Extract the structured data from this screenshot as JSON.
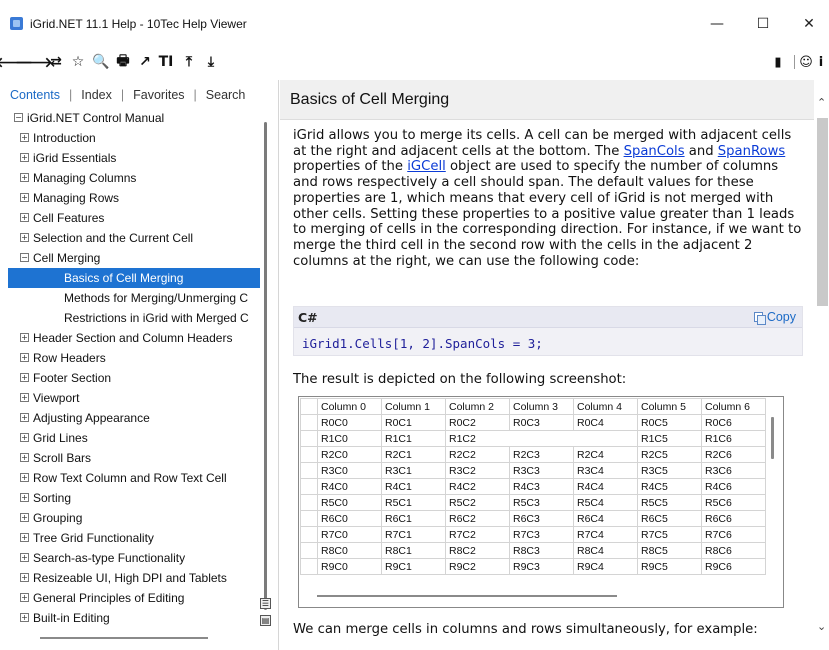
{
  "window": {
    "title": "iGrid.NET 11.1 Help - 10Tec Help Viewer",
    "minimize": "—",
    "maximize": "☐",
    "close": "✕"
  },
  "toolbar": {
    "left_icons": [
      {
        "name": "back-icon",
        "glyph": "🡐"
      },
      {
        "name": "forward-icon",
        "glyph": "🡒"
      },
      {
        "name": "sync-icon",
        "glyph": "⇄"
      },
      {
        "name": "add-favorite-icon",
        "glyph": "☆"
      },
      {
        "name": "search-icon",
        "glyph": "🔍"
      },
      {
        "name": "print-icon",
        "glyph": "🖶"
      },
      {
        "name": "open-external-icon",
        "glyph": "↗"
      },
      {
        "name": "font-size-icon",
        "glyph": "TI"
      },
      {
        "name": "scroll-top-icon",
        "glyph": "⤒"
      },
      {
        "name": "scroll-bottom-icon",
        "glyph": "⤓"
      }
    ],
    "right_icons": [
      {
        "name": "book-icon",
        "glyph": "▮"
      },
      {
        "name": "smiley-icon",
        "glyph": "☺"
      },
      {
        "name": "info-icon",
        "glyph": "i"
      }
    ]
  },
  "nav": {
    "tabs": [
      "Contents",
      "Index",
      "Favorites",
      "Search"
    ],
    "active_tab": "Contents"
  },
  "tree": [
    {
      "label": "iGrid.NET Control Manual",
      "indent": 0,
      "expander": "−"
    },
    {
      "label": "Introduction",
      "indent": 1,
      "expander": "+"
    },
    {
      "label": "iGrid Essentials",
      "indent": 1,
      "expander": "+"
    },
    {
      "label": "Managing Columns",
      "indent": 1,
      "expander": "+"
    },
    {
      "label": "Managing Rows",
      "indent": 1,
      "expander": "+"
    },
    {
      "label": "Cell Features",
      "indent": 1,
      "expander": "+"
    },
    {
      "label": "Selection and the Current Cell",
      "indent": 1,
      "expander": "+"
    },
    {
      "label": "Cell Merging",
      "indent": 1,
      "expander": "−"
    },
    {
      "label": "Basics of Cell Merging",
      "indent": 2,
      "expander": "",
      "selected": true
    },
    {
      "label": "Methods for Merging/Unmerging C",
      "indent": 2,
      "expander": ""
    },
    {
      "label": "Restrictions in iGrid with Merged C",
      "indent": 2,
      "expander": ""
    },
    {
      "label": "Header Section and Column Headers",
      "indent": 1,
      "expander": "+"
    },
    {
      "label": "Row Headers",
      "indent": 1,
      "expander": "+"
    },
    {
      "label": "Footer Section",
      "indent": 1,
      "expander": "+"
    },
    {
      "label": "Viewport",
      "indent": 1,
      "expander": "+"
    },
    {
      "label": "Adjusting Appearance",
      "indent": 1,
      "expander": "+"
    },
    {
      "label": "Grid Lines",
      "indent": 1,
      "expander": "+"
    },
    {
      "label": "Scroll Bars",
      "indent": 1,
      "expander": "+"
    },
    {
      "label": "Row Text Column and Row Text Cell",
      "indent": 1,
      "expander": "+"
    },
    {
      "label": "Sorting",
      "indent": 1,
      "expander": "+"
    },
    {
      "label": "Grouping",
      "indent": 1,
      "expander": "+"
    },
    {
      "label": "Tree Grid Functionality",
      "indent": 1,
      "expander": "+"
    },
    {
      "label": "Search-as-type Functionality",
      "indent": 1,
      "expander": "+"
    },
    {
      "label": "Resizeable UI, High DPI and Tablets",
      "indent": 1,
      "expander": "+"
    },
    {
      "label": "General Principles of Editing",
      "indent": 1,
      "expander": "+"
    },
    {
      "label": "Built-in Editing",
      "indent": 1,
      "expander": "+"
    }
  ],
  "topic": {
    "title": "Basics of Cell Merging",
    "intro_segments": [
      {
        "text": "iGrid allows you to merge its cells. A cell can be merged with adjacent cells at the right and adjacent cells at the bottom. The "
      },
      {
        "text": "SpanCols",
        "link": true
      },
      {
        "text": " and "
      },
      {
        "text": "SpanRows",
        "link": true
      },
      {
        "text": " properties of the "
      },
      {
        "text": "iGCell",
        "link": true
      },
      {
        "text": " object are used to specify the number of columns and rows respectively a cell should span. The default values for these properties are 1, which means that every cell of iGrid is not merged with other cells. Setting these properties to a positive value greater than 1 leads to merging of cells in the corresponding direction. For instance, if we want to merge the third cell in the second row with the cells in the adjacent 2 columns at the right, we can use the following code:"
      }
    ],
    "code": {
      "language": "C#",
      "copy_label": "Copy",
      "line": "iGrid1.Cells[1, 2].SpanCols = 3;"
    },
    "result_text": "The result is depicted on the following screenshot:",
    "grid": {
      "columns": [
        "Column 0",
        "Column 1",
        "Column 2",
        "Column 3",
        "Column 4",
        "Column 5",
        "Column 6"
      ],
      "rows": [
        [
          "R0C0",
          "R0C1",
          "R0C2",
          "R0C3",
          "R0C4",
          "R0C5",
          "R0C6"
        ],
        [
          "R1C0",
          "R1C1",
          "R1C2",
          "",
          "",
          "R1C5",
          "R1C6"
        ],
        [
          "R2C0",
          "R2C1",
          "R2C2",
          "R2C3",
          "R2C4",
          "R2C5",
          "R2C6"
        ],
        [
          "R3C0",
          "R3C1",
          "R3C2",
          "R3C3",
          "R3C4",
          "R3C5",
          "R3C6"
        ],
        [
          "R4C0",
          "R4C1",
          "R4C2",
          "R4C3",
          "R4C4",
          "R4C5",
          "R4C6"
        ],
        [
          "R5C0",
          "R5C1",
          "R5C2",
          "R5C3",
          "R5C4",
          "R5C5",
          "R5C6"
        ],
        [
          "R6C0",
          "R6C1",
          "R6C2",
          "R6C3",
          "R6C4",
          "R6C5",
          "R6C6"
        ],
        [
          "R7C0",
          "R7C1",
          "R7C2",
          "R7C3",
          "R7C4",
          "R7C5",
          "R7C6"
        ],
        [
          "R8C0",
          "R8C1",
          "R8C2",
          "R8C3",
          "R8C4",
          "R8C5",
          "R8C6"
        ],
        [
          "R9C0",
          "R9C1",
          "R9C2",
          "R9C3",
          "R9C4",
          "R9C5",
          "R9C6"
        ]
      ]
    },
    "after_text": "We can merge cells in columns and rows simultaneously, for example:"
  },
  "colors": {
    "selection": "#1e73d2",
    "link": "#0b3bd6",
    "tab_active": "#1b6ac6",
    "code_text": "#1f1f9a"
  }
}
